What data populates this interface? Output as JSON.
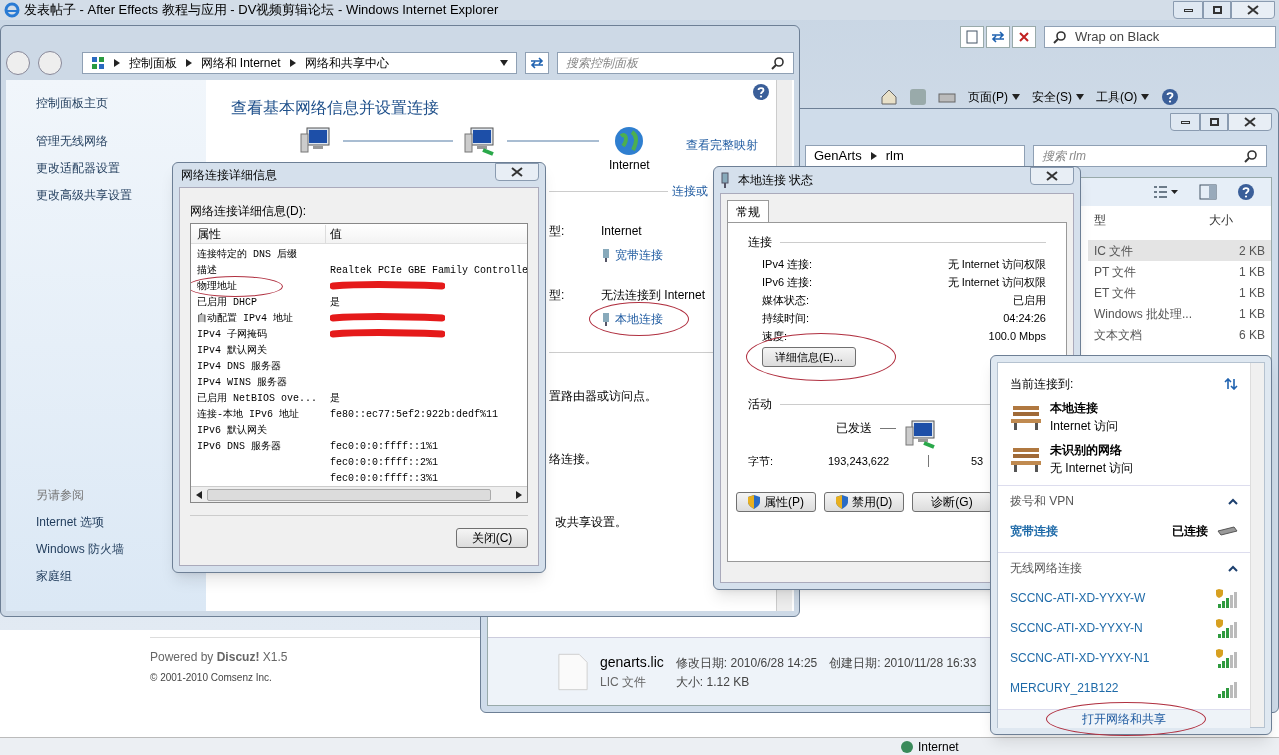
{
  "ie": {
    "title": "发表帖子 - After Effects 教程与应用 - DV视频剪辑论坛 - Windows Internet Explorer",
    "search": {
      "value": "Wrap on Black"
    },
    "commands": [
      "页面(P)",
      "安全(S)",
      "工具(O)"
    ],
    "footer": {
      "powered": "Powered by **Discuz!** X1.5",
      "copyright": "© 2001-2010 Comsenz Inc."
    },
    "status": "Internet"
  },
  "explorer": {
    "path": [
      "GenArts",
      "rlm"
    ],
    "search": {
      "placeholder": "搜索 rlm"
    },
    "columns": [
      "型",
      "大小"
    ],
    "rows": [
      {
        "type": "IC 文件",
        "size": "2 KB",
        "selected": true
      },
      {
        "type": "PT 文件",
        "size": "1 KB",
        "selected": false
      },
      {
        "type": "ET 文件",
        "size": "1 KB",
        "selected": false
      },
      {
        "type": "Windows 批处理...",
        "size": "1 KB",
        "selected": false
      },
      {
        "type": "文本文档",
        "size": "6 KB",
        "selected": false
      }
    ],
    "details": {
      "name": "genarts.lic",
      "modified": "修改日期: 2010/6/28 14:25",
      "created": "创建日期: 2010/11/28 16:33",
      "type": "LIC 文件",
      "size": "大小: 1.12 KB"
    }
  },
  "control_panel": {
    "path": [
      "控制面板",
      "网络和 Internet",
      "网络和共享中心"
    ],
    "search": {
      "placeholder": "搜索控制面板"
    },
    "sidebar": {
      "items": [
        "控制面板主页",
        "管理无线网络",
        "更改适配器设置",
        "更改高级共享设置"
      ],
      "see_also_title": "另请参阅",
      "see_also": [
        "Internet 选项",
        "Windows 防火墙",
        "家庭组"
      ]
    },
    "heading": "查看基本网络信息并设置连接",
    "map_label": "Internet",
    "map_link": "查看完整映射",
    "connect_link": "连接或",
    "networks": [
      {
        "label": "型:",
        "access": "Internet",
        "connection": "宽带连接",
        "circled": false
      },
      {
        "label": "型:",
        "access": "无法连接到 Internet",
        "connection": "本地连接",
        "circled": true
      }
    ],
    "texts": [
      "置路由器或访问点。",
      "络连接。",
      "改共享设置。"
    ]
  },
  "details_dialog": {
    "title": "网络连接详细信息",
    "label": "网络连接详细信息(D):",
    "columns": [
      "属性",
      "值"
    ],
    "rows": [
      {
        "property": "连接特定的 DNS 后缀",
        "redacted": false,
        "circled": false
      },
      {
        "property": "描述",
        "value": "Realtek PCIe GBE Family Controlle",
        "redacted": false,
        "circled": false
      },
      {
        "property": "物理地址",
        "redacted": true,
        "circled": true
      },
      {
        "property": "已启用 DHCP",
        "value": "是",
        "redacted": false,
        "circled": false
      },
      {
        "property": "自动配置 IPv4 地址",
        "redacted": true,
        "circled": false
      },
      {
        "property": "IPv4 子网掩码",
        "redacted": true,
        "circled": false
      },
      {
        "property": "IPv4 默认网关",
        "redacted": false,
        "circled": false
      },
      {
        "property": "IPv4 DNS 服务器",
        "redacted": false,
        "circled": false
      },
      {
        "property": "IPv4 WINS 服务器",
        "redacted": false,
        "circled": false
      },
      {
        "property": "已启用 NetBIOS ove...",
        "value": "是",
        "redacted": false,
        "circled": false
      },
      {
        "property": "连接-本地 IPv6 地址",
        "value": "fe80::ec77:5ef2:922b:dedf%11",
        "redacted": false,
        "circled": false
      },
      {
        "property": "IPv6 默认网关",
        "redacted": false,
        "circled": false
      },
      {
        "property": "IPv6 DNS 服务器",
        "value": "fec0:0:0:ffff::1%1",
        "redacted": false,
        "circled": false
      },
      {
        "value": "fec0:0:0:ffff::2%1",
        "redacted": false,
        "circled": false
      },
      {
        "value": "fec0:0:0:ffff::3%1",
        "redacted": false,
        "circled": false
      }
    ],
    "close_button": "关闭(C)"
  },
  "status_dialog": {
    "title": "本地连接 状态",
    "tabs": [
      {
        "label": "常规",
        "selected": true
      }
    ],
    "connection_title": "连接",
    "rows": [
      {
        "label": "IPv4 连接:",
        "value": "无 Internet 访问权限"
      },
      {
        "label": "IPv6 连接:",
        "value": "无 Internet 访问权限"
      },
      {
        "label": "媒体状态:",
        "value": "已启用"
      },
      {
        "label": "持续时间:",
        "value": "04:24:26"
      },
      {
        "label": "速度:",
        "value": "100.0 Mbps"
      }
    ],
    "details_button": {
      "label": "详细信息(E)...",
      "circled": true
    },
    "activity_title": "活动",
    "sent": "已发送",
    "bytes_label": "字节:",
    "sent_bytes": "193,243,622",
    "received_bytes": "53",
    "buttons": [
      {
        "label": "属性(P)",
        "kind": "shield"
      },
      {
        "label": "禁用(D)",
        "kind": "shield"
      },
      {
        "label": "诊断(G)",
        "kind": "plain"
      }
    ]
  },
  "flyout": {
    "current_title": "当前连接到:",
    "current": [
      {
        "name": "本地连接",
        "access": "Internet 访问"
      },
      {
        "name": "未识别的网络",
        "access": "无 Internet 访问"
      }
    ],
    "sections": [
      {
        "title": "拨号和 VPN",
        "expanded": true,
        "items": [
          {
            "kind": "dialup",
            "name": "宽带连接",
            "status": "已连接"
          }
        ]
      },
      {
        "title": "无线网络连接",
        "expanded": true,
        "items": [
          {
            "kind": "wifi",
            "name": "SCCNC-ATI-XD-YYXY-W",
            "secured": true
          },
          {
            "kind": "wifi",
            "name": "SCCNC-ATI-XD-YYXY-N",
            "secured": true
          },
          {
            "kind": "wifi",
            "name": "SCCNC-ATI-XD-YYXY-N1",
            "secured": true
          },
          {
            "kind": "wifi",
            "name": "MERCURY_21B122",
            "secured": false
          }
        ]
      }
    ],
    "footer_link": {
      "label": "打开网络和共享",
      "circled": true
    }
  }
}
